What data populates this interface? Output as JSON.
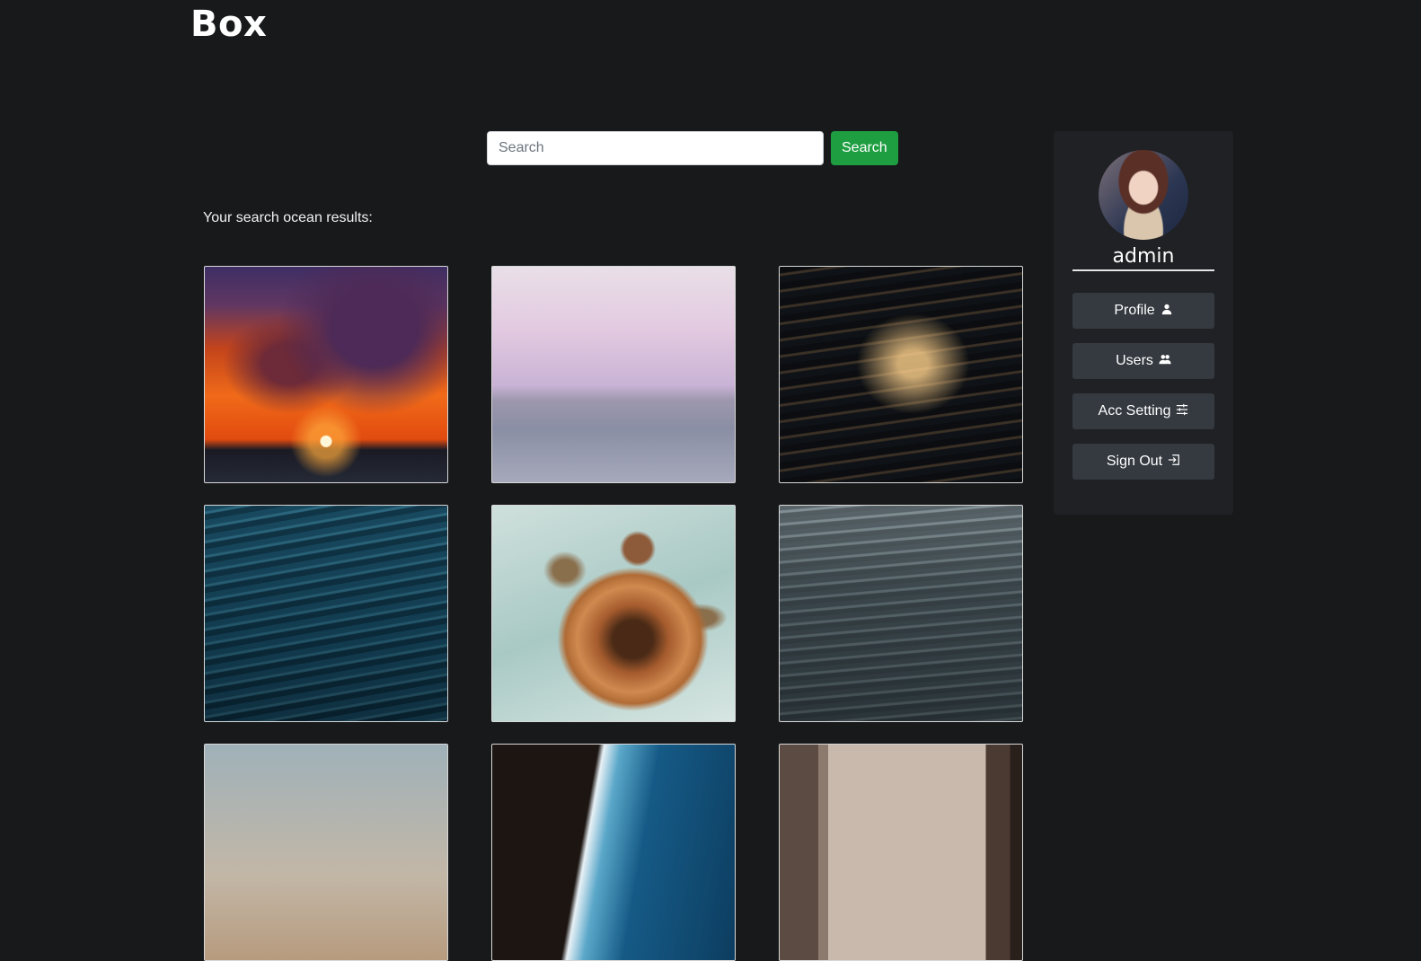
{
  "brand": "Box",
  "search": {
    "placeholder": "Search",
    "value": "",
    "button_label": "Search"
  },
  "results_label": "Your search ocean results:",
  "thumbnails": [
    {
      "icon": "sunset-over-ocean-image"
    },
    {
      "icon": "pink-sky-calm-sea-image"
    },
    {
      "icon": "golden-waves-image"
    },
    {
      "icon": "deep-blue-waves-image"
    },
    {
      "icon": "sea-turtle-image"
    },
    {
      "icon": "gray-water-image"
    },
    {
      "icon": "beach-horizon-image"
    },
    {
      "icon": "rocky-shore-aerial-image"
    },
    {
      "icon": "pier-sea-view-image"
    }
  ],
  "sidebar": {
    "username": "admin",
    "menu": [
      {
        "label": "Profile",
        "icon": "user-icon"
      },
      {
        "label": "Users",
        "icon": "users-icon"
      },
      {
        "label": "Acc Setting",
        "icon": "sliders-icon"
      },
      {
        "label": "Sign Out",
        "icon": "sign-out-icon"
      }
    ]
  },
  "colors": {
    "background": "#18191b",
    "sidebar": "#202124",
    "menu_button": "#343a40",
    "search_button": "#1e9e41"
  }
}
